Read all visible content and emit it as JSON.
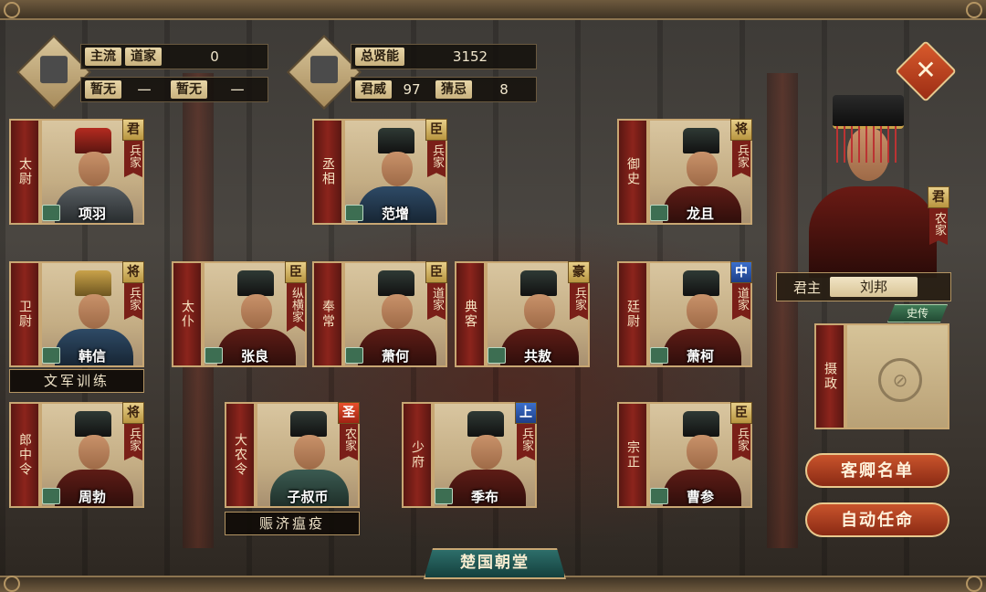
{
  "stats_left": {
    "row1": {
      "label1": "主流",
      "label2": "道家",
      "value": "0"
    },
    "row2": {
      "label1": "暂无",
      "value1": "一",
      "label2": "暂无",
      "value2": "一"
    }
  },
  "stats_mid": {
    "row1": {
      "label": "总贤能",
      "value": "3152"
    },
    "row2": {
      "label1": "君威",
      "value1": "97",
      "label2": "猜忌",
      "value2": "8"
    }
  },
  "close_label": "✕",
  "officers": {
    "taiwei": {
      "title": "太尉",
      "name": "项羽",
      "badge": "君",
      "school": "兵家"
    },
    "chengxiang": {
      "title": "丞相",
      "name": "范增",
      "badge": "臣",
      "school": "兵家"
    },
    "yushi": {
      "title": "御史",
      "name": "龙且",
      "badge": "将",
      "school": "兵家"
    },
    "weiwei": {
      "title": "卫尉",
      "name": "韩信",
      "badge": "将",
      "school": "兵家"
    },
    "taipu": {
      "title": "太仆",
      "name": "张良",
      "badge": "臣",
      "school": "纵横家"
    },
    "fengchang": {
      "title": "奉常",
      "name": "萧何",
      "badge": "臣",
      "school": "道家"
    },
    "dianke": {
      "title": "典客",
      "name": "共敖",
      "badge": "豪",
      "school": "兵家"
    },
    "tingwei": {
      "title": "廷尉",
      "name": "萧柯",
      "badge": "中",
      "school": "道家"
    },
    "langzhongling": {
      "title": "郎中令",
      "name": "周勃",
      "badge": "将",
      "school": "兵家"
    },
    "danongling": {
      "title": "大农令",
      "name": "子叔币",
      "badge": "圣",
      "school": "农家"
    },
    "shaofu": {
      "title": "少府",
      "name": "季布",
      "badge": "上",
      "school": "兵家"
    },
    "zongzheng": {
      "title": "宗正",
      "name": "曹参",
      "badge": "臣",
      "school": "兵家"
    }
  },
  "sub_labels": {
    "weiwei": "文军训练",
    "danongling": "赈济瘟疫"
  },
  "ruler": {
    "badge": "君",
    "school": "农家",
    "label": "君主",
    "name": "刘邦",
    "history_btn": "史传"
  },
  "regent": {
    "title": "摄政"
  },
  "buttons": {
    "guest_list": "客卿名单",
    "auto_appoint": "自动任命"
  },
  "court_title": "楚国朝堂"
}
